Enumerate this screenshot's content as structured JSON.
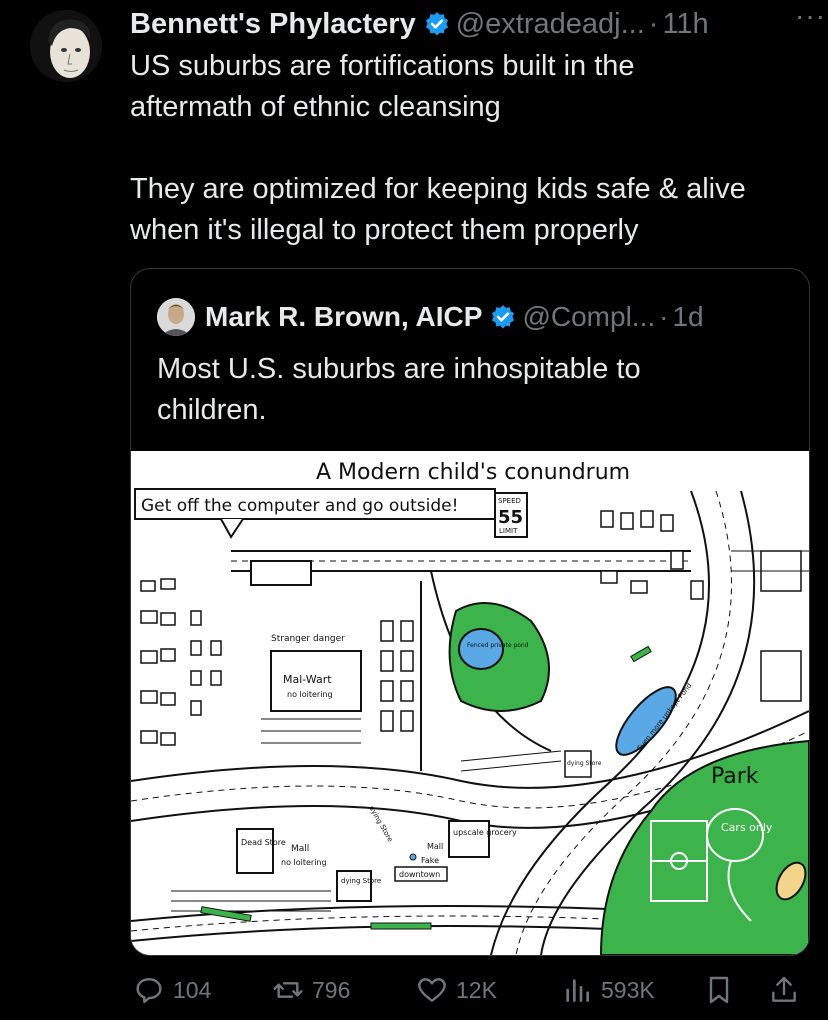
{
  "post": {
    "author_name": "Bennett's Phylactery",
    "author_handle": "@extradeadj...",
    "time_sep": "·",
    "time": "11h",
    "more": "···",
    "text_line1": "US suburbs are fortifications built in the",
    "text_line2": "aftermath of ethnic cleansing",
    "text_line3": "They are optimized for keeping kids safe & alive",
    "text_line4": "when it's illegal to protect them properly"
  },
  "quote": {
    "author_name": "Mark R. Brown, AICP",
    "author_handle": "@Compl...",
    "time_sep": "·",
    "time": "1d",
    "text_line1": "Most U.S. suburbs are inhospitable to",
    "text_line2": "children."
  },
  "map": {
    "title": "A Modern child's conundrum",
    "banner": "Get off the computer and go outside!",
    "speed_top": "SPEED",
    "speed_num": "55",
    "speed_bottom": "LIMIT",
    "stranger": "Stranger danger",
    "malwart": "Mal-Wart",
    "malwart_sub": "no loitering",
    "dead_store": "Dead Store",
    "mall": "Mall",
    "mall_sub": "no loitering",
    "dying_store_1": "dying Store",
    "dying_store_2": "dying Store",
    "dying_store_3": "dying Store",
    "upscale": "upscale grocery",
    "mall2": "Mall",
    "fake": "Fake",
    "downtown": "downtown",
    "park": "Park",
    "cars_only": "Cars only",
    "pond": "Even more unkept Pond",
    "gated_pond": "Fenced private pond",
    "colors": {
      "grass": "#3cb44b",
      "water": "#5aa9e6"
    }
  },
  "actions": {
    "replies": "104",
    "reposts": "796",
    "likes": "12K",
    "views": "593K"
  },
  "colors": {
    "verified": "#1d9bf0",
    "muted": "#71767b",
    "text": "#e7e9ea"
  }
}
